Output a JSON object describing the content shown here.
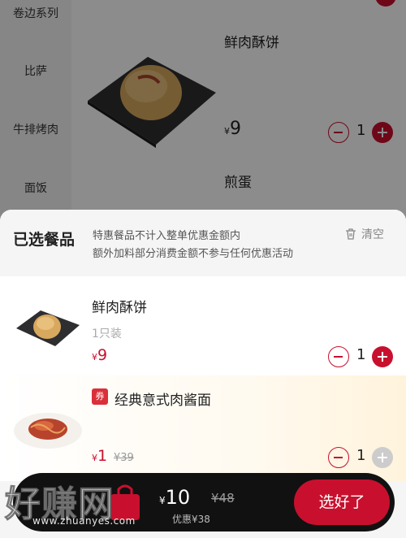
{
  "sidebar": {
    "items": [
      {
        "label": "卷边系列"
      },
      {
        "label": "比萨"
      },
      {
        "label": "牛排烤肉"
      },
      {
        "label": "面饭"
      }
    ]
  },
  "menu": {
    "dish1": {
      "name": "鲜肉酥饼",
      "currency": "¥",
      "price": "9",
      "quantity": "1"
    },
    "dish2": {
      "name": "煎蛋"
    }
  },
  "cart": {
    "title": "已选餐品",
    "notice_line1": "特惠餐品不计入整单优惠金额内",
    "notice_line2": "额外加料部分消费金额不参与任何优惠活动",
    "clear_label": "清空",
    "items": [
      {
        "name": "鲜肉酥饼",
        "spec": "1只装",
        "currency": "¥",
        "price": "9",
        "quantity": "1"
      },
      {
        "name": "经典意式肉酱面",
        "badge": "券",
        "currency": "¥",
        "price": "1",
        "original_price": "¥39",
        "quantity": "1"
      }
    ]
  },
  "bottom_bar": {
    "currency": "¥",
    "total": "10",
    "original_total": "¥48",
    "discount_text": "优惠¥38",
    "submit_label": "选好了"
  },
  "watermark": {
    "text": "好赚网",
    "url": "www.zhuanyes.com"
  },
  "colors": {
    "accent": "#c8102e",
    "bar": "#111111",
    "sheet": "#f5f5f5"
  },
  "icons": [
    "trash-icon",
    "minus-icon",
    "plus-icon",
    "shopping-bag-icon"
  ]
}
